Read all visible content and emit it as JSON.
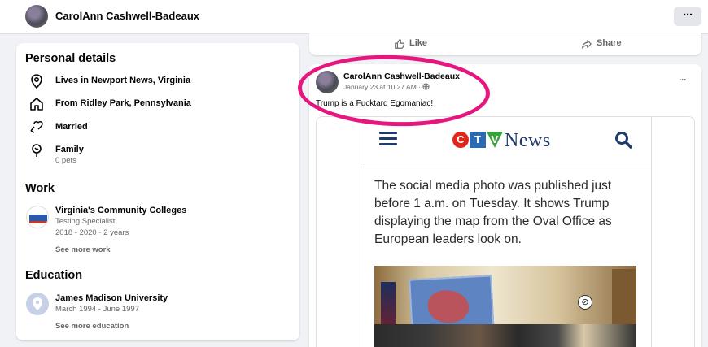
{
  "profile": {
    "name": "CarolAnn Cashwell-Badeaux",
    "more_label": "···"
  },
  "personal": {
    "title": "Personal details",
    "items": [
      {
        "icon": "location-pin-icon",
        "text": "Lives in Newport News, Virginia",
        "sub": ""
      },
      {
        "icon": "home-icon",
        "text": "From Ridley Park, Pennsylvania",
        "sub": ""
      },
      {
        "icon": "heart-icon",
        "text": "Married",
        "sub": ""
      },
      {
        "icon": "family-icon",
        "text": "Family",
        "sub": "0 pets"
      }
    ]
  },
  "work": {
    "title": "Work",
    "employer": "Virginia's Community Colleges",
    "role": "Testing Specialist",
    "dates": "2018 - 2020 · 2 years",
    "see_more": "See more work"
  },
  "education": {
    "title": "Education",
    "school": "James Madison University",
    "dates": "March 1994 - June 1997",
    "see_more": "See more education"
  },
  "actions": {
    "like": "Like",
    "share": "Share"
  },
  "post": {
    "author": "CarolAnn Cashwell-Badeaux",
    "time": "January 23 at 10:27 AM · ",
    "text": "Trump is a Fucktard Egomaniac!",
    "menu": "···",
    "highlight_color": "#e5177e"
  },
  "news": {
    "brand_letters": [
      "C",
      "T",
      "V"
    ],
    "brand_word": "News",
    "article": "The social media photo was published just before 1 a.m. on Tuesday. It shows Trump displaying the map from the Oval Office as European leaders look on.",
    "brand_colors": {
      "c": "#e1261c",
      "t": "#2a6ab3",
      "v": "#3aa23a",
      "navy": "#1f3a6b"
    },
    "noview_glyph": "⊘"
  }
}
